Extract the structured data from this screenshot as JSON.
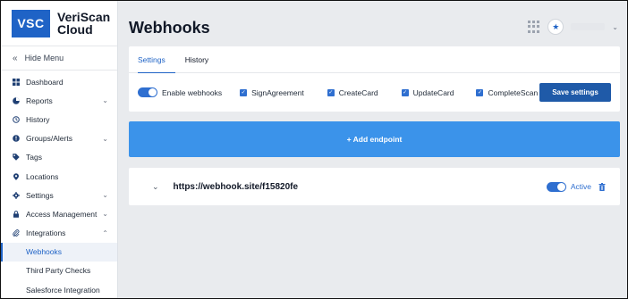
{
  "brand": {
    "logo_text": "VSC",
    "name_line1": "VeriScan",
    "name_line2": "Cloud"
  },
  "sidebar": {
    "hide_menu": "Hide Menu",
    "items": [
      {
        "label": "Dashboard",
        "icon": "dashboard-icon",
        "caret": ""
      },
      {
        "label": "Reports",
        "icon": "reports-icon",
        "caret": "⌄"
      },
      {
        "label": "History",
        "icon": "history-icon",
        "caret": ""
      },
      {
        "label": "Groups/Alerts",
        "icon": "alert-icon",
        "caret": "⌄"
      },
      {
        "label": "Tags",
        "icon": "tag-icon",
        "caret": ""
      },
      {
        "label": "Locations",
        "icon": "location-icon",
        "caret": ""
      },
      {
        "label": "Settings",
        "icon": "gear-icon",
        "caret": "⌄"
      },
      {
        "label": "Access Management",
        "icon": "lock-icon",
        "caret": "⌄"
      },
      {
        "label": "Integrations",
        "icon": "paperclip-icon",
        "caret": "⌃"
      }
    ],
    "subitems": [
      {
        "label": "Webhooks",
        "active": true
      },
      {
        "label": "Third Party Checks",
        "active": false
      },
      {
        "label": "Salesforce Integration",
        "active": false
      }
    ]
  },
  "header": {
    "title": "Webhooks"
  },
  "tabs": [
    {
      "label": "Settings",
      "active": true
    },
    {
      "label": "History",
      "active": false
    }
  ],
  "options": {
    "enable_webhooks": "Enable webhooks",
    "events": [
      "SignAgreement",
      "CreateCard",
      "UpdateCard",
      "CompleteScan"
    ],
    "save_label": "Save settings"
  },
  "add_endpoint": {
    "label": "+ Add endpoint"
  },
  "endpoint": {
    "url": "https://webhook.site/f15820fe",
    "status": "Active"
  },
  "colors": {
    "accent": "#1f63c6",
    "button": "#1f5aa8",
    "add_bar": "#3b93ea"
  }
}
